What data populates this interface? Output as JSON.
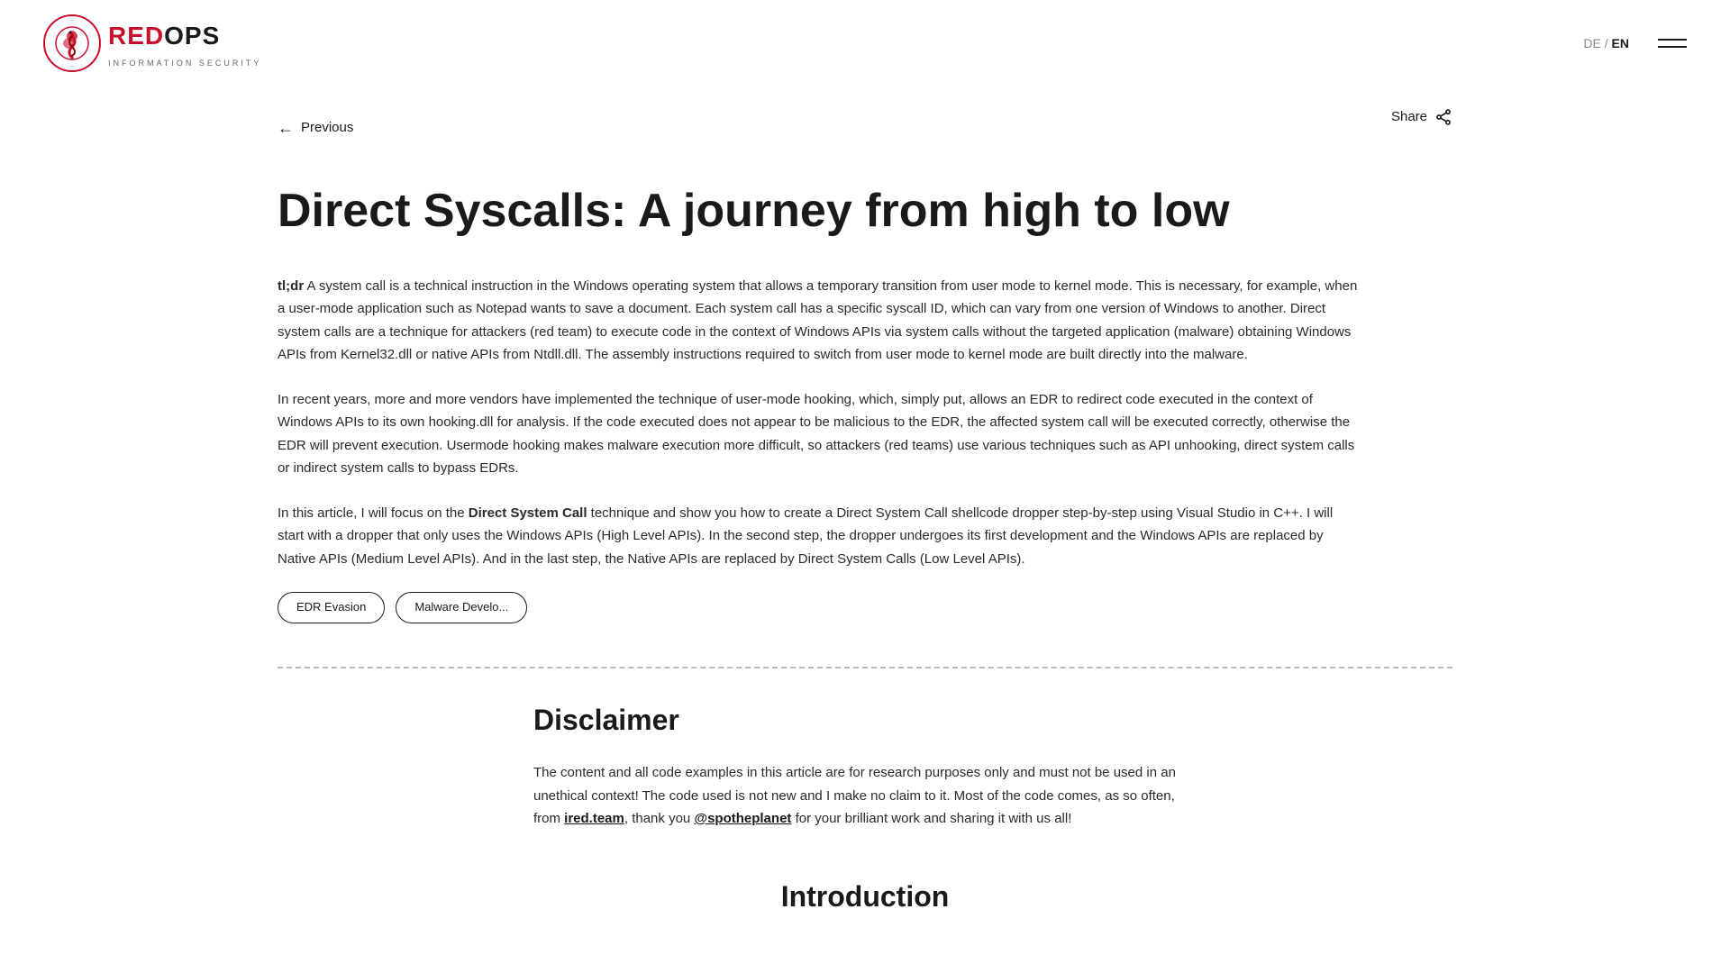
{
  "navbar": {
    "logo_brand_red": "RED",
    "logo_brand_ops": "OPS",
    "logo_subtitle": "INFORMATION SECURITY",
    "lang_de": "DE",
    "lang_separator": " / ",
    "lang_en": "EN"
  },
  "article": {
    "previous_label": "Previous",
    "share_label": "Share",
    "title": "Direct Syscalls: A journey from high to low",
    "paragraphs": [
      {
        "has_tldr": true,
        "tldr_label": "tl;dr",
        "text": " A system call is a technical instruction in the Windows operating system that allows a temporary transition from user mode to kernel mode. This is necessary, for example, when a user-mode application such as Notepad wants to save a document. Each system call has a specific syscall ID, which can vary from one version of Windows to another. Direct system calls are a technique for attackers (red team) to execute code in the context of Windows APIs via system calls without the targeted application (malware) obtaining Windows APIs from Kernel32.dll or native APIs from Ntdll.dll. The assembly instructions required to switch from user mode to kernel mode are built directly into the malware."
      },
      {
        "has_tldr": false,
        "text": "In recent years, more and more vendors have implemented the technique of user-mode hooking, which, simply put, allows an EDR to redirect code executed in the context of Windows APIs to its own hooking.dll for analysis. If the code executed does not appear to be malicious to the EDR, the affected system call will be executed correctly, otherwise the EDR will prevent execution. Usermode hooking makes malware execution more difficult, so attackers (red teams) use various techniques such as API unhooking, direct system calls or indirect system calls to bypass EDRs."
      },
      {
        "has_tldr": false,
        "has_bold": true,
        "bold_phrase": "Direct System Call",
        "text_before": "In this article, I will focus on the ",
        "text_after": " technique and show you how to create a Direct System Call shellcode dropper step-by-step using Visual Studio in C++. I will start with a dropper that only uses the Windows APIs (High Level APIs). In the second step, the dropper undergoes its first development and the Windows APIs are replaced by Native APIs (Medium Level APIs). And in the last step, the Native APIs are replaced by Direct System Calls (Low Level APIs)."
      }
    ],
    "tags": [
      {
        "label": "EDR Evasion"
      },
      {
        "label": "Malware Develo..."
      }
    ],
    "disclaimer": {
      "title": "Disclaimer",
      "body_before": "The content and all code examples in this article are for research purposes only and must not be used in an unethical context! The code used is not new and I make no claim to it. Most of the code comes, as so often, from ",
      "ired_team_text": "ired.team",
      "body_middle": ", thank you ",
      "spotheplanet_text": "@spotheplanet",
      "body_after": " for your brilliant work and sharing it with us all!"
    },
    "introduction_title": "Introduction"
  }
}
